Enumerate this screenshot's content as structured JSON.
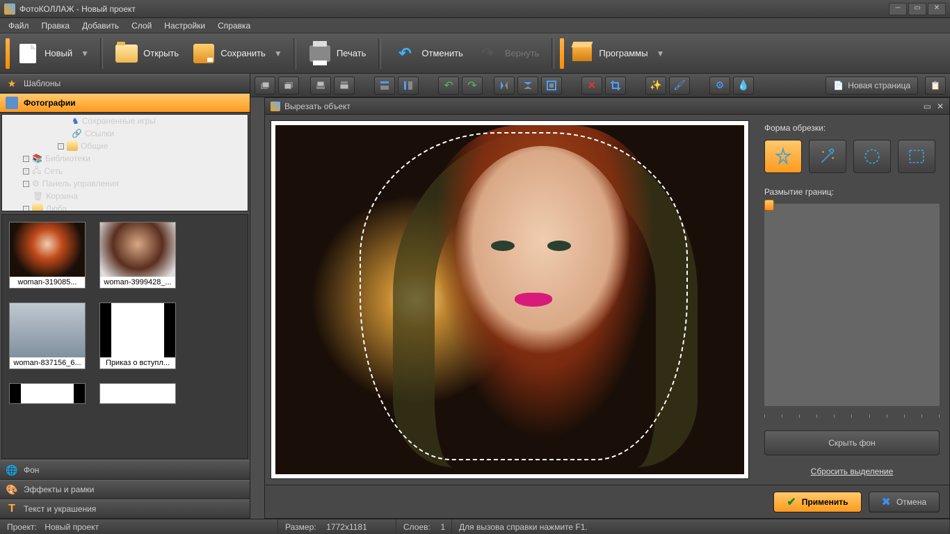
{
  "title": "ФотоКОЛЛАЖ - Новый проект",
  "menu": {
    "file": "Файл",
    "edit": "Правка",
    "add": "Добавить",
    "layer": "Слой",
    "settings": "Настройки",
    "help": "Справка"
  },
  "toolbar": {
    "new": "Новый",
    "open": "Открыть",
    "save": "Сохранить",
    "print": "Печать",
    "undo": "Отменить",
    "redo": "Вернуть",
    "programs": "Программы"
  },
  "left": {
    "templates": "Шаблоны",
    "photos": "Фотографии",
    "background": "Фон",
    "effects": "Эффекты и рамки",
    "text": "Текст и украшения",
    "tree": {
      "saved": "Сохраненные игры",
      "links": "Ссылки",
      "common": "Общие",
      "libs": "Библиотеки",
      "network": "Сеть",
      "ctrl": "Панель управления",
      "trash": "Корзина",
      "luba": "Люба"
    },
    "thumbs": [
      "woman-319085...",
      "woman-3999428_...",
      "woman-837156_6...",
      "Приказ о вступл..."
    ]
  },
  "ctb": {
    "new_page": "Новая страница"
  },
  "dialog": {
    "title": "Вырезать объект",
    "shape_label": "Форма обрезки:",
    "blur_label": "Размытие границ:",
    "hide_bg": "Скрыть фон",
    "reset": "Сбросить выделение",
    "apply": "Применить",
    "cancel": "Отмена"
  },
  "status": {
    "project_lbl": "Проект:",
    "project_val": "Новый проект",
    "size_lbl": "Размер:",
    "size_val": "1772x1181",
    "layers_lbl": "Слоев:",
    "layers_val": "1",
    "help": "Для вызова справки нажмите F1."
  }
}
